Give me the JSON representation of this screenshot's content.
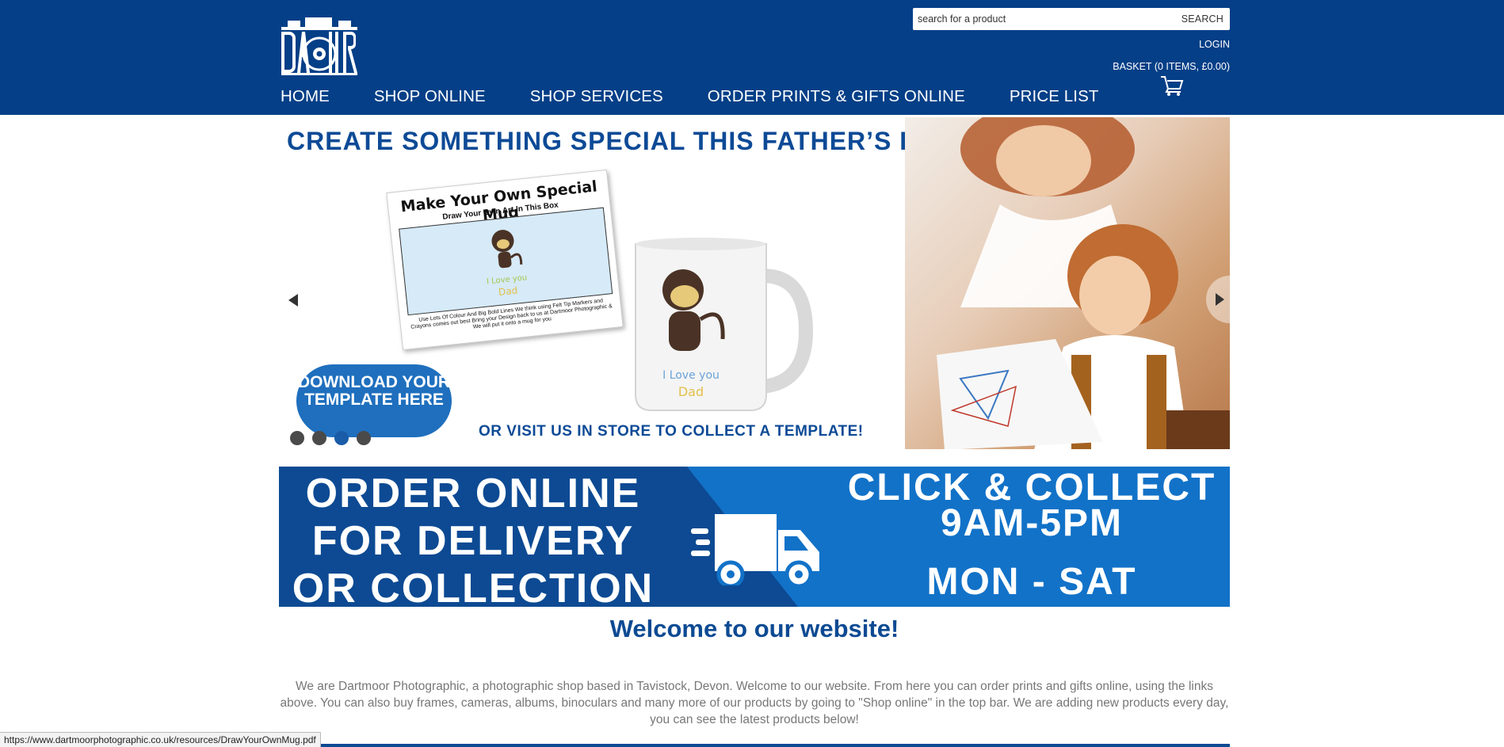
{
  "header": {
    "logo_text": "DARTMOOR PHOTOGRAPHIC",
    "search": {
      "placeholder": "search for a product",
      "button_label": "SEARCH"
    },
    "login_label": "LOGIN",
    "basket_label": "BASKET (0 ITEMS, £0.00)",
    "nav": [
      {
        "label": "HOME"
      },
      {
        "label": "SHOP ONLINE"
      },
      {
        "label": "SHOP SERVICES"
      },
      {
        "label": "ORDER PRINTS & GIFTS ONLINE"
      },
      {
        "label": "PRICE LIST"
      }
    ]
  },
  "slider": {
    "headline": "CREATE SOMETHING SPECIAL THIS FATHER’S DAY",
    "template_title": "Make Your Own Special Mug",
    "template_subtitle": "Draw Your Own Art In This Box",
    "template_note": "Use Lots Of Colour And Big Bold Lines We think using Felt Tip Markers and Crayons comes out best Bring your Design back to us at Dartmoor Photographic & We will put it onto a mug for you",
    "drawing_caption_line1": "I Love you",
    "drawing_caption_line2": "Dad",
    "download_button": "DOWNLOAD YOUR TEMPLATE HERE",
    "visit_text": "OR VISIT US IN STORE TO COLLECT A TEMPLATE!",
    "dots": 4,
    "active_dot": 3
  },
  "banner": {
    "left_lines": [
      "ORDER ONLINE",
      "FOR DELIVERY",
      "OR COLLECTION"
    ],
    "right_line1": "CLICK & COLLECT",
    "right_line2": "9AM-5PM",
    "right_line3": "MON - SAT"
  },
  "welcome": {
    "title": "Welcome to our website!",
    "text": "We are Dartmoor Photographic, a photographic shop based in Tavistock, Devon. Welcome to our website. From here you can order prints and gifts online, using the links above. You can also buy frames, cameras, albums, binoculars and many more of our products by going to \"Shop online\" in the top bar. We are adding new products every day, you can see the latest products below!"
  },
  "status_bar": {
    "url": "https://www.dartmoorphotographic.co.uk/resources/DrawYourOwnMug.pdf"
  },
  "colors": {
    "header_bg": "#043f87",
    "brand_blue": "#0d4a93",
    "accent_blue": "#1272c8",
    "body_text": "#777777"
  }
}
